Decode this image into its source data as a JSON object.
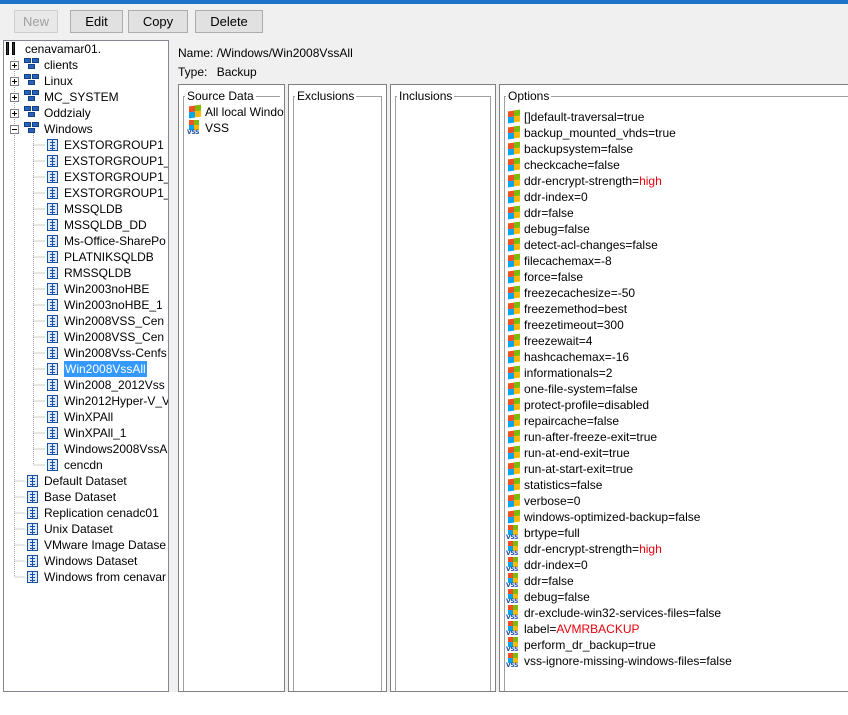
{
  "toolbar": {
    "new_label": "New",
    "edit_label": "Edit",
    "copy_label": "Copy",
    "delete_label": "Delete"
  },
  "tree": {
    "root": "cenavamar01.",
    "top_groups": [
      "clients",
      "Linux",
      "MC_SYSTEM",
      "Oddzialy",
      "Windows"
    ],
    "windows_children": [
      "EXSTORGROUP1",
      "EXSTORGROUP1_",
      "EXSTORGROUP1_",
      "EXSTORGROUP1_",
      "MSSQLDB",
      "MSSQLDB_DD",
      "Ms-Office-SharePo",
      "PLATNIKSQLDB",
      "RMSSQLDB",
      "Win2003noHBE",
      "Win2003noHBE_1",
      "Win2008VSS_Cen",
      "Win2008VSS_Cen",
      "Win2008Vss-Cenfs",
      "Win2008VssAll",
      "Win2008_2012Vss",
      "Win2012Hyper-V_V",
      "WinXPAll",
      "WinXPAll_1",
      "Windows2008VssA",
      "cencdn"
    ],
    "datasets": [
      "Default Dataset",
      "Base Dataset",
      "Replication cenadc01",
      "Unix Dataset",
      "VMware Image Datase",
      "Windows Dataset",
      "Windows from cenavar"
    ],
    "selected": "Win2008VssAll"
  },
  "header": {
    "name_label": "Name:",
    "name_value": "/Windows/Win2008VssAll",
    "type_label": "Type:",
    "type_value": "Backup"
  },
  "panes": {
    "source_title": "Source Data",
    "exclusions_title": "Exclusions",
    "inclusions_title": "Inclusions",
    "options_title": "Options"
  },
  "source_items": [
    {
      "icon": "windows-icon",
      "text": "All local Windo"
    },
    {
      "icon": "vss-icon",
      "text": "VSS"
    }
  ],
  "options": [
    {
      "icon": "windows-icon",
      "key": "[]default-traversal=",
      "value": "true",
      "highlight": false
    },
    {
      "icon": "windows-icon",
      "key": "backup_mounted_vhds=",
      "value": "true",
      "highlight": false
    },
    {
      "icon": "windows-icon",
      "key": "backupsystem=",
      "value": "false",
      "highlight": false
    },
    {
      "icon": "windows-icon",
      "key": "checkcache=",
      "value": "false",
      "highlight": false
    },
    {
      "icon": "windows-icon",
      "key": "ddr-encrypt-strength=",
      "value": "high",
      "highlight": true
    },
    {
      "icon": "windows-icon",
      "key": "ddr-index=",
      "value": "0",
      "highlight": false
    },
    {
      "icon": "windows-icon",
      "key": "ddr=",
      "value": "false",
      "highlight": false
    },
    {
      "icon": "windows-icon",
      "key": "debug=",
      "value": "false",
      "highlight": false
    },
    {
      "icon": "windows-icon",
      "key": "detect-acl-changes=",
      "value": "false",
      "highlight": false
    },
    {
      "icon": "windows-icon",
      "key": "filecachemax=",
      "value": "-8",
      "highlight": false
    },
    {
      "icon": "windows-icon",
      "key": "force=",
      "value": "false",
      "highlight": false
    },
    {
      "icon": "windows-icon",
      "key": "freezecachesize=",
      "value": "-50",
      "highlight": false
    },
    {
      "icon": "windows-icon",
      "key": "freezemethod=",
      "value": "best",
      "highlight": false
    },
    {
      "icon": "windows-icon",
      "key": "freezetimeout=",
      "value": "300",
      "highlight": false
    },
    {
      "icon": "windows-icon",
      "key": "freezewait=",
      "value": "4",
      "highlight": false
    },
    {
      "icon": "windows-icon",
      "key": "hashcachemax=",
      "value": "-16",
      "highlight": false
    },
    {
      "icon": "windows-icon",
      "key": "informationals=",
      "value": "2",
      "highlight": false
    },
    {
      "icon": "windows-icon",
      "key": "one-file-system=",
      "value": "false",
      "highlight": false
    },
    {
      "icon": "windows-icon",
      "key": "protect-profile=",
      "value": "disabled",
      "highlight": false
    },
    {
      "icon": "windows-icon",
      "key": "repaircache=",
      "value": "false",
      "highlight": false
    },
    {
      "icon": "windows-icon",
      "key": "run-after-freeze-exit=",
      "value": "true",
      "highlight": false
    },
    {
      "icon": "windows-icon",
      "key": "run-at-end-exit=",
      "value": "true",
      "highlight": false
    },
    {
      "icon": "windows-icon",
      "key": "run-at-start-exit=",
      "value": "true",
      "highlight": false
    },
    {
      "icon": "windows-icon",
      "key": "statistics=",
      "value": "false",
      "highlight": false
    },
    {
      "icon": "windows-icon",
      "key": "verbose=",
      "value": "0",
      "highlight": false
    },
    {
      "icon": "windows-icon",
      "key": "windows-optimized-backup=",
      "value": "false",
      "highlight": false
    },
    {
      "icon": "vss-icon",
      "key": "brtype=",
      "value": "full",
      "highlight": false
    },
    {
      "icon": "vss-icon",
      "key": "ddr-encrypt-strength=",
      "value": "high",
      "highlight": true
    },
    {
      "icon": "vss-icon",
      "key": "ddr-index=",
      "value": "0",
      "highlight": false
    },
    {
      "icon": "vss-icon",
      "key": "ddr=",
      "value": "false",
      "highlight": false
    },
    {
      "icon": "vss-icon",
      "key": "debug=",
      "value": "false",
      "highlight": false
    },
    {
      "icon": "vss-icon",
      "key": "dr-exclude-win32-services-files=",
      "value": "false",
      "highlight": false
    },
    {
      "icon": "vss-icon",
      "key": "label=",
      "value": "AVMRBACKUP",
      "highlight": true
    },
    {
      "icon": "vss-icon",
      "key": "perform_dr_backup=",
      "value": "true",
      "highlight": false
    },
    {
      "icon": "vss-icon",
      "key": "vss-ignore-missing-windows-files=",
      "value": "false",
      "highlight": false
    }
  ],
  "icons": {
    "vss_label": "VSS"
  },
  "colors": {
    "selection": "#3399ff",
    "highlight_value": "#e8000b",
    "title_bar": "#1e73c8"
  }
}
